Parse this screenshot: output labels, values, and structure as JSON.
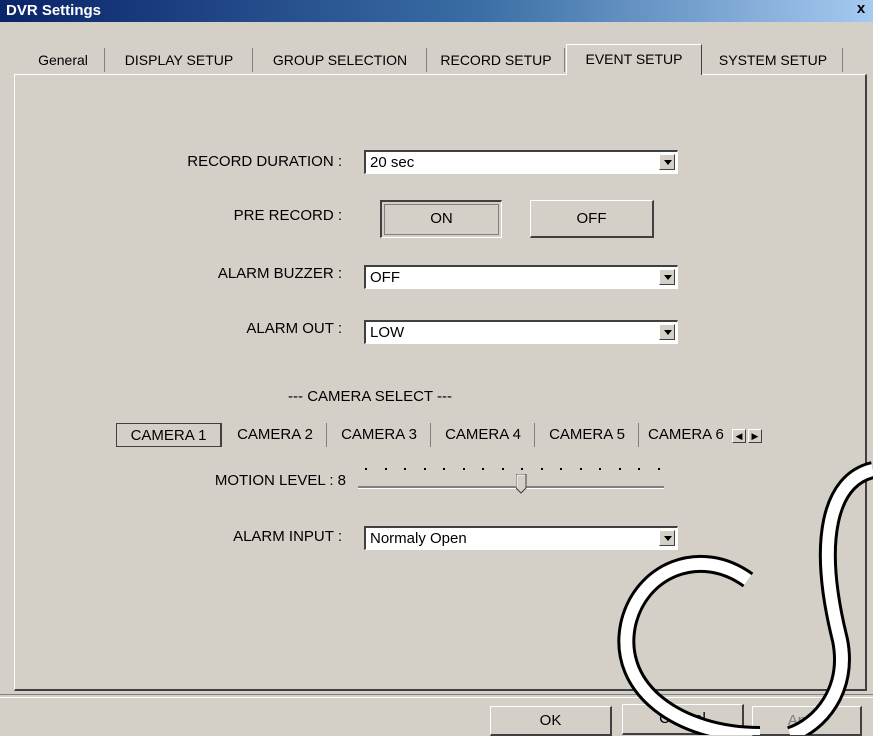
{
  "window": {
    "title": "DVR Settings",
    "close_glyph": "x"
  },
  "tabs": [
    {
      "label": "General"
    },
    {
      "label": "DISPLAY SETUP"
    },
    {
      "label": "GROUP SELECTION"
    },
    {
      "label": "RECORD SETUP"
    },
    {
      "label": "EVENT SETUP"
    },
    {
      "label": "SYSTEM SETUP"
    }
  ],
  "active_tab": "EVENT SETUP",
  "record_duration": {
    "label": "RECORD DURATION :",
    "value": "20 sec"
  },
  "pre_record": {
    "label": "PRE RECORD :",
    "on_label": "ON",
    "off_label": "OFF",
    "selected": "ON"
  },
  "alarm_buzzer": {
    "label": "ALARM BUZZER :",
    "value": "OFF"
  },
  "alarm_out": {
    "label": "ALARM OUT :",
    "value": "LOW"
  },
  "camera_select": {
    "heading": "--- CAMERA SELECT ---",
    "cameras": [
      "CAMERA 1",
      "CAMERA 2",
      "CAMERA 3",
      "CAMERA 4",
      "CAMERA 5",
      "CAMERA 6"
    ],
    "selected": "CAMERA 1"
  },
  "motion_level": {
    "label": "MOTION LEVEL : 8",
    "value": 8,
    "max": 15
  },
  "alarm_input": {
    "label": "ALARM INPUT :",
    "value": "Normaly Open"
  },
  "footer": {
    "ok_label": "OK",
    "cancel_label": "Cancel",
    "apply_label": "Apply"
  },
  "icons": {
    "combo_arrow": "chevron-down-icon",
    "scroll_left": "arrow-left-icon",
    "scroll_right": "arrow-right-icon"
  }
}
